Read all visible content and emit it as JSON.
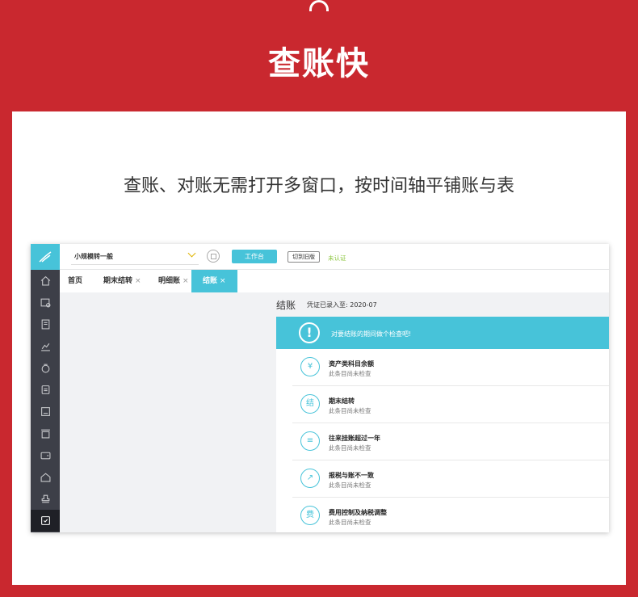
{
  "banner": {
    "title": "查账快"
  },
  "card": {
    "subtitle": "查账、对账无需打开多窗口，按时间轴平铺账与表"
  },
  "app": {
    "company": "小规模转一般",
    "workbench_label": "工作台",
    "switch_old_label": "切到旧版",
    "verify_status": "未认证",
    "tabs": [
      {
        "label": "首页"
      },
      {
        "label": "期末结转",
        "close": "×"
      },
      {
        "label": "明细账",
        "close": "×"
      },
      {
        "label": "结账",
        "close": "×"
      }
    ],
    "header": {
      "title": "结账",
      "entered_until": "凭证已录入至: 2020-07"
    },
    "notice": {
      "icon": "!",
      "text": "对要结账的期间做个检查吧!"
    },
    "checks": [
      {
        "icon": "¥",
        "title": "资产类科目余额",
        "status": "此条目尚未检查"
      },
      {
        "icon": "结",
        "title": "期末结转",
        "status": "此条目尚未检查"
      },
      {
        "icon": "≡",
        "title": "往来挂账超过一年",
        "status": "此条目尚未检查"
      },
      {
        "icon": "↗",
        "title": "报税与账不一致",
        "status": "此条目尚未检查"
      },
      {
        "icon": "费",
        "title": "费用控制及纳税调整",
        "status": "此条目尚未检查"
      }
    ],
    "colors": {
      "accent": "#47c3d9",
      "banner": "#c9282f",
      "rail": "#3d3f48",
      "verify": "#8cc63f"
    }
  }
}
